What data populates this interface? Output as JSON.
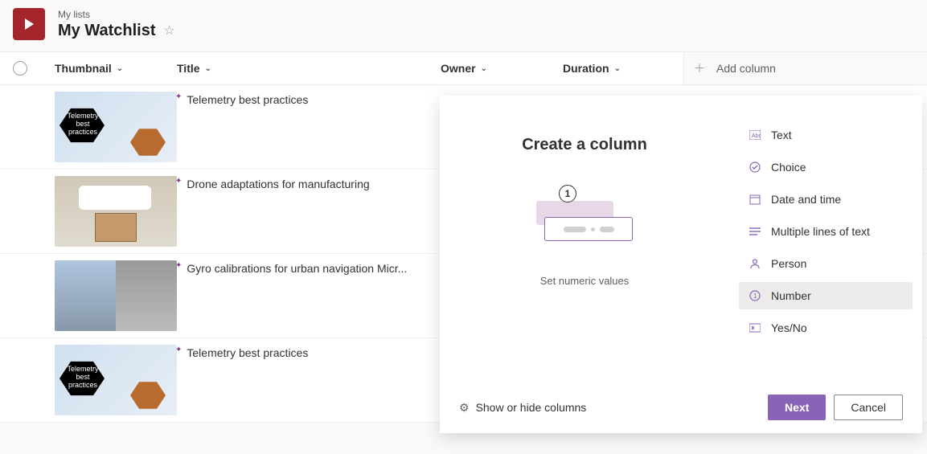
{
  "header": {
    "breadcrumb": "My lists",
    "title": "My Watchlist"
  },
  "columns": {
    "thumbnail": "Thumbnail",
    "title": "Title",
    "owner": "Owner",
    "duration": "Duration",
    "add": "Add column"
  },
  "rows": [
    {
      "title": "Telemetry best practices",
      "thumb_label": "Telemetry best practices"
    },
    {
      "title": "Drone adaptations for manufacturing",
      "thumb_label": ""
    },
    {
      "title": "Gyro calibrations for urban navigation Micr...",
      "thumb_label": ""
    },
    {
      "title": "Telemetry best practices",
      "thumb_label": "Telemetry best practices"
    }
  ],
  "panel": {
    "title": "Create a column",
    "subtitle": "Set numeric values",
    "preview_number": "1",
    "types": [
      {
        "label": "Text"
      },
      {
        "label": "Choice"
      },
      {
        "label": "Date and time"
      },
      {
        "label": "Multiple lines of text"
      },
      {
        "label": "Person"
      },
      {
        "label": "Number"
      },
      {
        "label": "Yes/No"
      }
    ],
    "selected_type_index": 5,
    "footer_link": "Show or hide columns",
    "next": "Next",
    "cancel": "Cancel"
  }
}
